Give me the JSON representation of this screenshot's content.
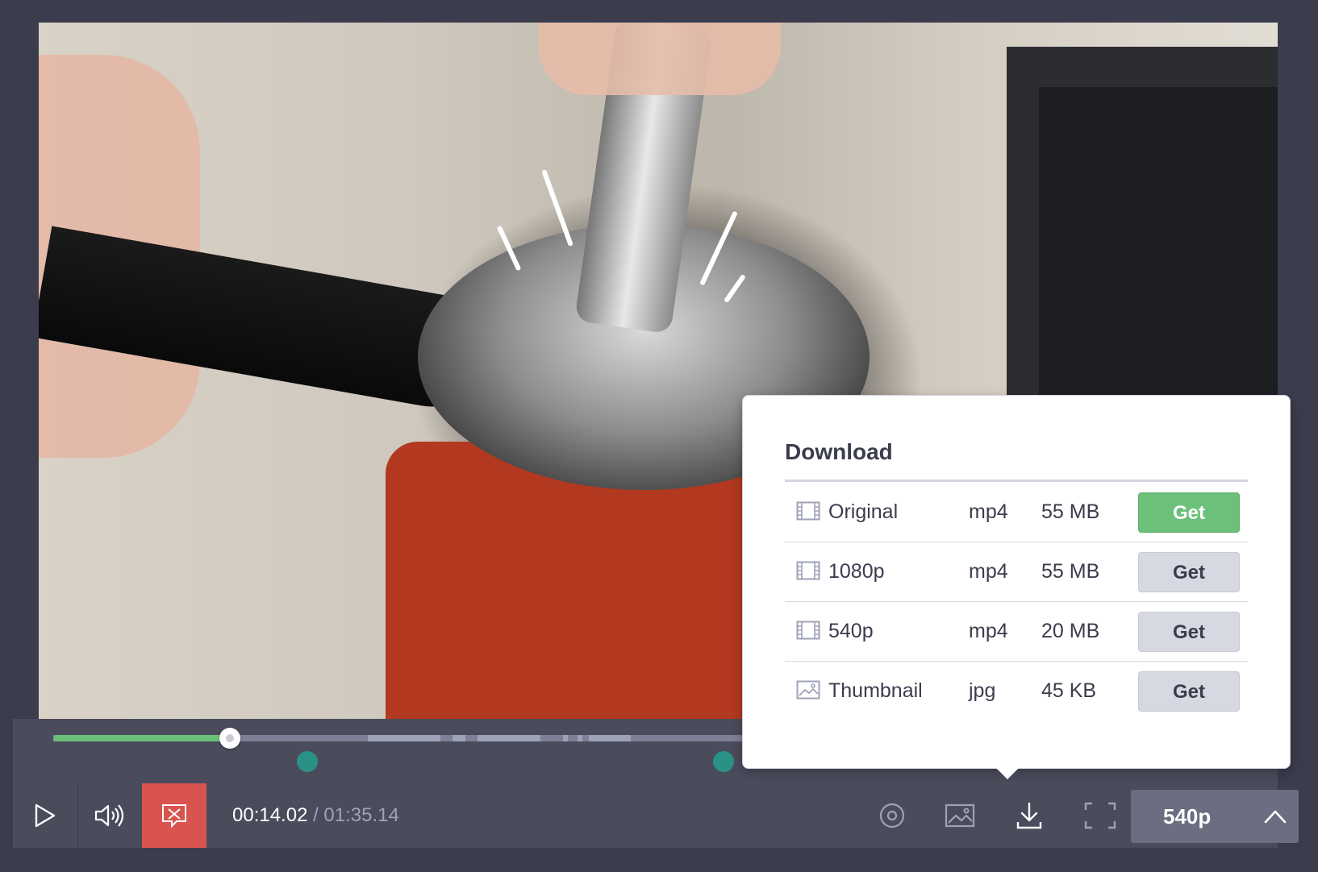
{
  "player": {
    "current_time": "00:14.02",
    "total_time": "/ 01:35.14",
    "quality_label": "540p"
  },
  "timeline": {
    "progress_fraction": 0.143
  },
  "download_popup": {
    "title": "Download",
    "rows": [
      {
        "icon": "film-icon",
        "name": "Original",
        "format": "mp4",
        "size": "55 MB",
        "button": "Get",
        "primary": true
      },
      {
        "icon": "film-icon",
        "name": "1080p",
        "format": "mp4",
        "size": "55 MB",
        "button": "Get",
        "primary": false
      },
      {
        "icon": "film-icon",
        "name": "540p",
        "format": "mp4",
        "size": "20 MB",
        "button": "Get",
        "primary": false
      },
      {
        "icon": "image-icon",
        "name": "Thumbnail",
        "format": "jpg",
        "size": "45 KB",
        "button": "Get",
        "primary": false
      }
    ]
  },
  "colors": {
    "accent_green": "#6cc17a",
    "recording_red": "#d9534f",
    "marker_teal": "#2a9187",
    "chrome_dark": "#3b3d4d"
  }
}
